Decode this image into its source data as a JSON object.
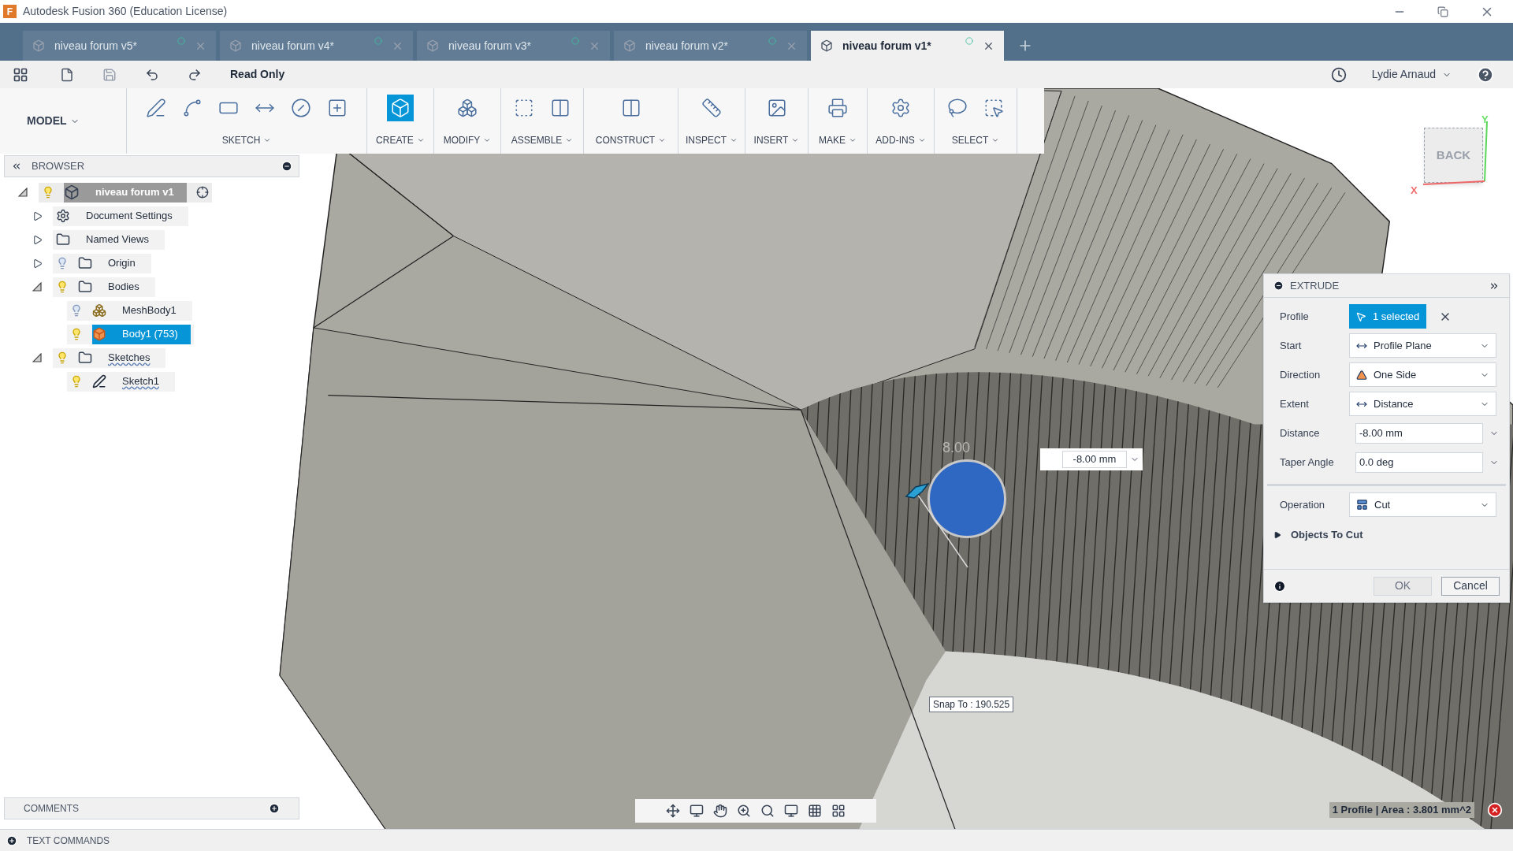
{
  "window": {
    "logo_letter": "F",
    "title": "Autodesk Fusion 360 (Education License)"
  },
  "tabs": [
    {
      "label": "niveau forum v5*",
      "selected": false
    },
    {
      "label": "niveau forum v4*",
      "selected": false
    },
    {
      "label": "niveau forum v3*",
      "selected": false
    },
    {
      "label": "niveau forum v2*",
      "selected": false
    },
    {
      "label": "niveau forum v1*",
      "selected": true
    }
  ],
  "quick_access": {
    "mode": "Read Only",
    "user": "Lydie Arnaud"
  },
  "toolbar": {
    "workspace": "MODEL",
    "groups": [
      {
        "label": "SKETCH",
        "active": false
      },
      {
        "label": "CREATE",
        "active": true
      },
      {
        "label": "MODIFY",
        "active": false
      },
      {
        "label": "ASSEMBLE",
        "active": false
      },
      {
        "label": "CONSTRUCT",
        "active": false
      },
      {
        "label": "INSPECT",
        "active": false
      },
      {
        "label": "INSERT",
        "active": false
      },
      {
        "label": "MAKE",
        "active": false
      },
      {
        "label": "ADD-INS",
        "active": false
      },
      {
        "label": "SELECT",
        "active": false
      }
    ]
  },
  "browser": {
    "title": "BROWSER",
    "tree": [
      {
        "kind": "component",
        "label": "niveau forum v1",
        "expanded": true,
        "visible": true,
        "selected": false,
        "flagged": false,
        "children": [
          {
            "kind": "settings",
            "label": "Document Settings",
            "expanded": false,
            "selected": false,
            "flagged": false
          },
          {
            "kind": "folder",
            "label": "Named Views",
            "expanded": false,
            "selected": false,
            "flagged": false
          },
          {
            "kind": "folder",
            "label": "Origin",
            "expanded": false,
            "visible": false,
            "selected": false,
            "flagged": false
          },
          {
            "kind": "folder",
            "label": "Bodies",
            "expanded": true,
            "visible": true,
            "selected": false,
            "flagged": false,
            "children": [
              {
                "kind": "mesh",
                "label": "MeshBody1",
                "visible": false,
                "selected": false,
                "flagged": false
              },
              {
                "kind": "body",
                "label": "Body1 (753)",
                "visible": true,
                "selected": true,
                "flagged": false
              }
            ]
          },
          {
            "kind": "folder",
            "label": "Sketches",
            "expanded": true,
            "visible": true,
            "selected": false,
            "flagged": true,
            "children": [
              {
                "kind": "sketch",
                "label": "Sketch1",
                "visible": true,
                "selected": false,
                "flagged": true
              }
            ]
          }
        ]
      }
    ]
  },
  "viewport": {
    "dimension_label": "8.00",
    "distance_input": "-8.00 mm",
    "snap_tooltip": "Snap To : 190.525",
    "viewcube_face": "BACK",
    "axis_x": "X",
    "axis_y": "Y"
  },
  "extrude": {
    "title": "EXTRUDE",
    "rows": [
      {
        "kind": "selection",
        "label": "Profile",
        "value": "1 selected"
      },
      {
        "kind": "dropdown",
        "label": "Start",
        "value": "Profile Plane"
      },
      {
        "kind": "dropdown",
        "label": "Direction",
        "value": "One Side"
      },
      {
        "kind": "dropdown",
        "label": "Extent",
        "value": "Distance"
      },
      {
        "kind": "input",
        "label": "Distance",
        "value": "-8.00 mm"
      },
      {
        "kind": "input",
        "label": "Taper Angle",
        "value": "0.0 deg"
      }
    ],
    "operation": {
      "label": "Operation",
      "value": "Cut"
    },
    "objects_to_cut": {
      "label": "Objects To Cut",
      "expanded": false
    },
    "buttons": [
      {
        "label": "OK",
        "disabled": true
      },
      {
        "label": "Cancel",
        "disabled": false
      }
    ]
  },
  "comments": {
    "title": "COMMENTS"
  },
  "status": {
    "text": "1 Profile | Area : 3.801 mm^2"
  },
  "text_commands": {
    "title": "TEXT COMMANDS"
  }
}
